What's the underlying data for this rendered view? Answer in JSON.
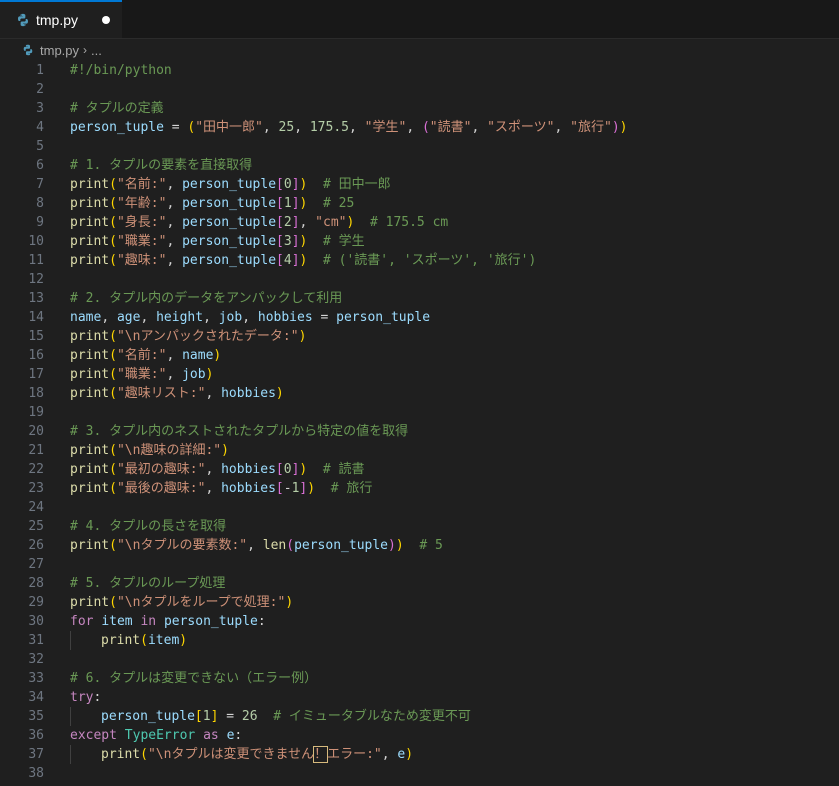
{
  "tab": {
    "label": "tmp.py",
    "modified": true
  },
  "breadcrumb": {
    "file": "tmp.py",
    "more": "..."
  },
  "lines": [
    {
      "n": "1",
      "t": [
        [
          "cm",
          "#!/bin/python"
        ]
      ]
    },
    {
      "n": "2",
      "t": []
    },
    {
      "n": "3",
      "t": [
        [
          "cm",
          "# タプルの定義"
        ]
      ]
    },
    {
      "n": "4",
      "t": [
        [
          "var",
          "person_tuple"
        ],
        [
          "op",
          " = "
        ],
        [
          "b1",
          "("
        ],
        [
          "st",
          "\"田中一郎\""
        ],
        [
          "op",
          ", "
        ],
        [
          "num",
          "25"
        ],
        [
          "op",
          ", "
        ],
        [
          "num",
          "175.5"
        ],
        [
          "op",
          ", "
        ],
        [
          "st",
          "\"学生\""
        ],
        [
          "op",
          ", "
        ],
        [
          "b2",
          "("
        ],
        [
          "st",
          "\"読書\""
        ],
        [
          "op",
          ", "
        ],
        [
          "st",
          "\"スポーツ\""
        ],
        [
          "op",
          ", "
        ],
        [
          "st",
          "\"旅行\""
        ],
        [
          "b2",
          ")"
        ],
        [
          "b1",
          ")"
        ]
      ]
    },
    {
      "n": "5",
      "t": []
    },
    {
      "n": "6",
      "t": [
        [
          "cm",
          "# 1. タプルの要素を直接取得"
        ]
      ]
    },
    {
      "n": "7",
      "t": [
        [
          "fn",
          "print"
        ],
        [
          "b1",
          "("
        ],
        [
          "st",
          "\"名前:\""
        ],
        [
          "op",
          ", "
        ],
        [
          "var",
          "person_tuple"
        ],
        [
          "b2",
          "["
        ],
        [
          "num",
          "0"
        ],
        [
          "b2",
          "]"
        ],
        [
          "b1",
          ")"
        ],
        [
          "op",
          "  "
        ],
        [
          "cm",
          "# 田中一郎"
        ]
      ]
    },
    {
      "n": "8",
      "t": [
        [
          "fn",
          "print"
        ],
        [
          "b1",
          "("
        ],
        [
          "st",
          "\"年齢:\""
        ],
        [
          "op",
          ", "
        ],
        [
          "var",
          "person_tuple"
        ],
        [
          "b2",
          "["
        ],
        [
          "num",
          "1"
        ],
        [
          "b2",
          "]"
        ],
        [
          "b1",
          ")"
        ],
        [
          "op",
          "  "
        ],
        [
          "cm",
          "# 25"
        ]
      ]
    },
    {
      "n": "9",
      "t": [
        [
          "fn",
          "print"
        ],
        [
          "b1",
          "("
        ],
        [
          "st",
          "\"身長:\""
        ],
        [
          "op",
          ", "
        ],
        [
          "var",
          "person_tuple"
        ],
        [
          "b2",
          "["
        ],
        [
          "num",
          "2"
        ],
        [
          "b2",
          "]"
        ],
        [
          "op",
          ", "
        ],
        [
          "st",
          "\"cm\""
        ],
        [
          "b1",
          ")"
        ],
        [
          "op",
          "  "
        ],
        [
          "cm",
          "# 175.5 cm"
        ]
      ]
    },
    {
      "n": "10",
      "t": [
        [
          "fn",
          "print"
        ],
        [
          "b1",
          "("
        ],
        [
          "st",
          "\"職業:\""
        ],
        [
          "op",
          ", "
        ],
        [
          "var",
          "person_tuple"
        ],
        [
          "b2",
          "["
        ],
        [
          "num",
          "3"
        ],
        [
          "b2",
          "]"
        ],
        [
          "b1",
          ")"
        ],
        [
          "op",
          "  "
        ],
        [
          "cm",
          "# 学生"
        ]
      ]
    },
    {
      "n": "11",
      "t": [
        [
          "fn",
          "print"
        ],
        [
          "b1",
          "("
        ],
        [
          "st",
          "\"趣味:\""
        ],
        [
          "op",
          ", "
        ],
        [
          "var",
          "person_tuple"
        ],
        [
          "b2",
          "["
        ],
        [
          "num",
          "4"
        ],
        [
          "b2",
          "]"
        ],
        [
          "b1",
          ")"
        ],
        [
          "op",
          "  "
        ],
        [
          "cm",
          "# ('読書', 'スポーツ', '旅行')"
        ]
      ]
    },
    {
      "n": "12",
      "t": []
    },
    {
      "n": "13",
      "t": [
        [
          "cm",
          "# 2. タプル内のデータをアンパックして利用"
        ]
      ]
    },
    {
      "n": "14",
      "t": [
        [
          "var",
          "name"
        ],
        [
          "op",
          ", "
        ],
        [
          "var",
          "age"
        ],
        [
          "op",
          ", "
        ],
        [
          "var",
          "height"
        ],
        [
          "op",
          ", "
        ],
        [
          "var",
          "job"
        ],
        [
          "op",
          ", "
        ],
        [
          "var",
          "hobbies"
        ],
        [
          "op",
          " = "
        ],
        [
          "var",
          "person_tuple"
        ]
      ]
    },
    {
      "n": "15",
      "t": [
        [
          "fn",
          "print"
        ],
        [
          "b1",
          "("
        ],
        [
          "st",
          "\"\\nアンパックされたデータ:\""
        ],
        [
          "b1",
          ")"
        ]
      ]
    },
    {
      "n": "16",
      "t": [
        [
          "fn",
          "print"
        ],
        [
          "b1",
          "("
        ],
        [
          "st",
          "\"名前:\""
        ],
        [
          "op",
          ", "
        ],
        [
          "var",
          "name"
        ],
        [
          "b1",
          ")"
        ]
      ]
    },
    {
      "n": "17",
      "t": [
        [
          "fn",
          "print"
        ],
        [
          "b1",
          "("
        ],
        [
          "st",
          "\"職業:\""
        ],
        [
          "op",
          ", "
        ],
        [
          "var",
          "job"
        ],
        [
          "b1",
          ")"
        ]
      ]
    },
    {
      "n": "18",
      "t": [
        [
          "fn",
          "print"
        ],
        [
          "b1",
          "("
        ],
        [
          "st",
          "\"趣味リスト:\""
        ],
        [
          "op",
          ", "
        ],
        [
          "var",
          "hobbies"
        ],
        [
          "b1",
          ")"
        ]
      ]
    },
    {
      "n": "19",
      "t": []
    },
    {
      "n": "20",
      "t": [
        [
          "cm",
          "# 3. タプル内のネストされたタプルから特定の値を取得"
        ]
      ]
    },
    {
      "n": "21",
      "t": [
        [
          "fn",
          "print"
        ],
        [
          "b1",
          "("
        ],
        [
          "st",
          "\"\\n趣味の詳細:\""
        ],
        [
          "b1",
          ")"
        ]
      ]
    },
    {
      "n": "22",
      "t": [
        [
          "fn",
          "print"
        ],
        [
          "b1",
          "("
        ],
        [
          "st",
          "\"最初の趣味:\""
        ],
        [
          "op",
          ", "
        ],
        [
          "var",
          "hobbies"
        ],
        [
          "b2",
          "["
        ],
        [
          "num",
          "0"
        ],
        [
          "b2",
          "]"
        ],
        [
          "b1",
          ")"
        ],
        [
          "op",
          "  "
        ],
        [
          "cm",
          "# 読書"
        ]
      ]
    },
    {
      "n": "23",
      "t": [
        [
          "fn",
          "print"
        ],
        [
          "b1",
          "("
        ],
        [
          "st",
          "\"最後の趣味:\""
        ],
        [
          "op",
          ", "
        ],
        [
          "var",
          "hobbies"
        ],
        [
          "b2",
          "["
        ],
        [
          "op",
          "-"
        ],
        [
          "num",
          "1"
        ],
        [
          "b2",
          "]"
        ],
        [
          "b1",
          ")"
        ],
        [
          "op",
          "  "
        ],
        [
          "cm",
          "# 旅行"
        ]
      ]
    },
    {
      "n": "24",
      "t": []
    },
    {
      "n": "25",
      "t": [
        [
          "cm",
          "# 4. タプルの長さを取得"
        ]
      ]
    },
    {
      "n": "26",
      "t": [
        [
          "fn",
          "print"
        ],
        [
          "b1",
          "("
        ],
        [
          "st",
          "\"\\nタプルの要素数:\""
        ],
        [
          "op",
          ", "
        ],
        [
          "fn",
          "len"
        ],
        [
          "b2",
          "("
        ],
        [
          "var",
          "person_tuple"
        ],
        [
          "b2",
          ")"
        ],
        [
          "b1",
          ")"
        ],
        [
          "op",
          "  "
        ],
        [
          "cm",
          "# 5"
        ]
      ]
    },
    {
      "n": "27",
      "t": []
    },
    {
      "n": "28",
      "t": [
        [
          "cm",
          "# 5. タプルのループ処理"
        ]
      ]
    },
    {
      "n": "29",
      "t": [
        [
          "fn",
          "print"
        ],
        [
          "b1",
          "("
        ],
        [
          "st",
          "\"\\nタプルをループで処理:\""
        ],
        [
          "b1",
          ")"
        ]
      ]
    },
    {
      "n": "30",
      "t": [
        [
          "kw",
          "for"
        ],
        [
          "op",
          " "
        ],
        [
          "var",
          "item"
        ],
        [
          "op",
          " "
        ],
        [
          "kw",
          "in"
        ],
        [
          "op",
          " "
        ],
        [
          "var",
          "person_tuple"
        ],
        [
          "op",
          ":"
        ]
      ]
    },
    {
      "n": "31",
      "indent": true,
      "t": [
        [
          "fn",
          "print"
        ],
        [
          "b1",
          "("
        ],
        [
          "var",
          "item"
        ],
        [
          "b1",
          ")"
        ]
      ]
    },
    {
      "n": "32",
      "t": []
    },
    {
      "n": "33",
      "t": [
        [
          "cm",
          "# 6. タプルは変更できない（エラー例）"
        ]
      ]
    },
    {
      "n": "34",
      "t": [
        [
          "kw",
          "try"
        ],
        [
          "op",
          ":"
        ]
      ]
    },
    {
      "n": "35",
      "indent": true,
      "t": [
        [
          "var",
          "person_tuple"
        ],
        [
          "b1",
          "["
        ],
        [
          "num",
          "1"
        ],
        [
          "b1",
          "]"
        ],
        [
          "op",
          " = "
        ],
        [
          "num",
          "26"
        ],
        [
          "op",
          "  "
        ],
        [
          "cm",
          "# イミュータブルなため変更不可"
        ]
      ]
    },
    {
      "n": "36",
      "t": [
        [
          "kw",
          "except"
        ],
        [
          "op",
          " "
        ],
        [
          "ty",
          "TypeError"
        ],
        [
          "op",
          " "
        ],
        [
          "kw",
          "as"
        ],
        [
          "op",
          " "
        ],
        [
          "var",
          "e"
        ],
        [
          "op",
          ":"
        ]
      ]
    },
    {
      "n": "37",
      "indent": true,
      "t": [
        [
          "fn",
          "print"
        ],
        [
          "b1",
          "("
        ],
        [
          "st",
          "\"\\nタプルは変更できません"
        ],
        [
          "warnbox",
          "！"
        ],
        [
          "st",
          "エラー:\""
        ],
        [
          "op",
          ", "
        ],
        [
          "var",
          "e"
        ],
        [
          "b1",
          ")"
        ]
      ]
    },
    {
      "n": "38",
      "t": []
    }
  ]
}
